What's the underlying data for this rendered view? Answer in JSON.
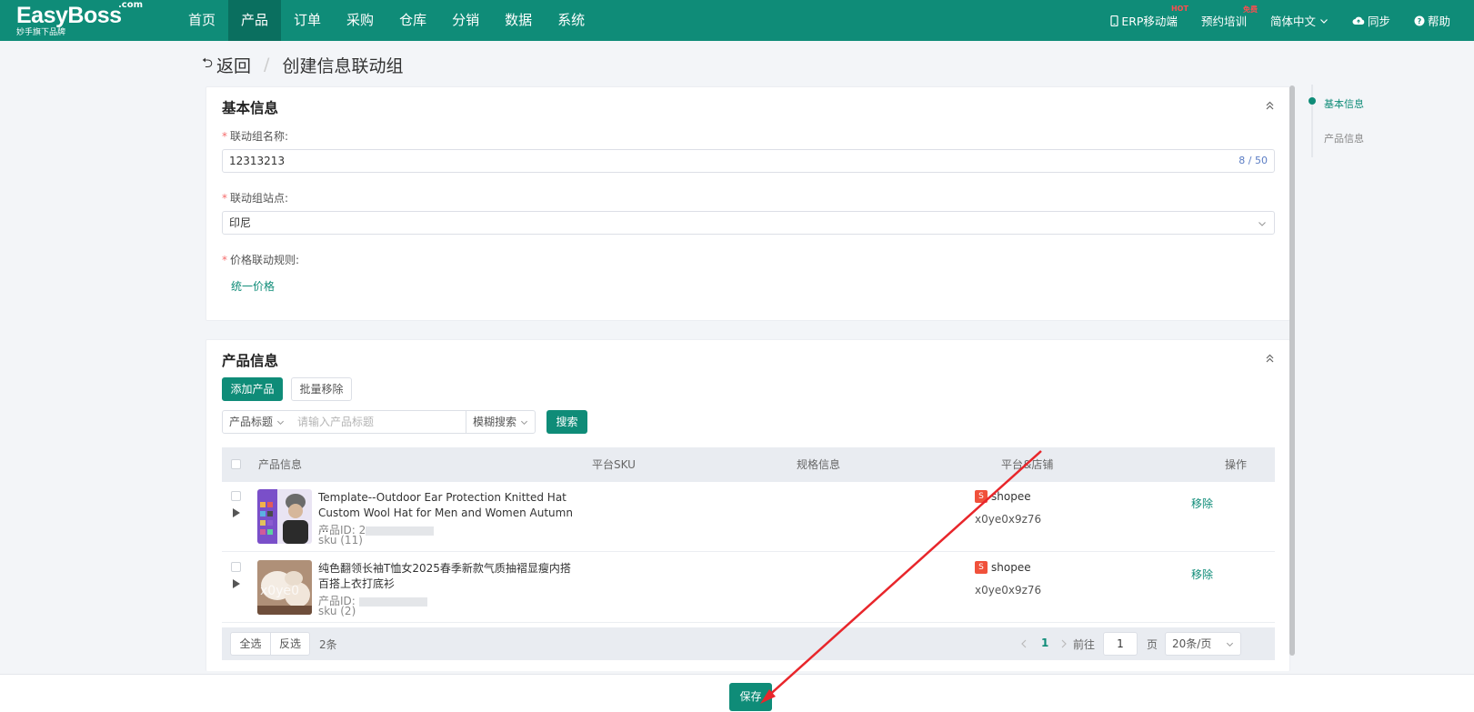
{
  "brand": {
    "name": "EasyBoss",
    "com": ".com",
    "tagline": "妙手旗下品牌"
  },
  "nav": {
    "items": [
      {
        "label": "首页",
        "active": false
      },
      {
        "label": "产品",
        "active": true
      },
      {
        "label": "订单",
        "active": false
      },
      {
        "label": "采购",
        "active": false
      },
      {
        "label": "仓库",
        "active": false
      },
      {
        "label": "分销",
        "active": false
      },
      {
        "label": "数据",
        "active": false
      },
      {
        "label": "系统",
        "active": false
      }
    ],
    "right": {
      "erp": "ERP移动端",
      "erp_badge": "HOT",
      "training": "预约培训",
      "training_badge": "免费",
      "language": "简体中文",
      "sync": "同步",
      "help": "帮助"
    }
  },
  "breadcrumb": {
    "back": "返回",
    "title": "创建信息联动组"
  },
  "basic": {
    "title": "基本信息",
    "name_label": "联动组名称:",
    "name_value": "12313213",
    "name_count": "8 / 50",
    "site_label": "联动组站点:",
    "site_value": "印尼",
    "price_label": "价格联动规则:",
    "price_value": "统一价格"
  },
  "products": {
    "title": "产品信息",
    "add_button": "添加产品",
    "batch_remove_button": "批量移除",
    "filter_field": "产品标题",
    "search_placeholder": "请输入产品标题",
    "match_mode": "模糊搜索",
    "search_button": "搜索",
    "columns": {
      "info": "产品信息",
      "sku": "平台SKU",
      "spec": "规格信息",
      "store": "平台&店铺",
      "action": "操作"
    },
    "rows": [
      {
        "title": "Template--Outdoor Ear Protection Knitted Hat Custom Wool Hat for Men and Women Autumn ...",
        "id_label": "产品ID: 2",
        "sku": "sku (11)",
        "platform": "shopee",
        "store": "x0ye0x9z76",
        "action": "移除"
      },
      {
        "title": "纯色翻领长袖T恤女2025春季新款气质抽褶显瘦内搭百搭上衣打底衫",
        "id_label": "产品ID: ",
        "sku": "sku (2)",
        "platform": "shopee",
        "store": "x0ye0x9z76",
        "action": "移除"
      }
    ],
    "footer": {
      "select_all": "全选",
      "invert": "反选",
      "total": "2条",
      "page": "1",
      "goto_label": "前往",
      "goto_value": "1",
      "page_unit": "页",
      "page_size": "20条/页"
    }
  },
  "anchor": {
    "items": [
      "基本信息",
      "产品信息"
    ]
  },
  "save_button": "保存",
  "colors": {
    "primary": "#0f8c78",
    "required": "#f56c6c",
    "annotation": "#e8262b"
  }
}
